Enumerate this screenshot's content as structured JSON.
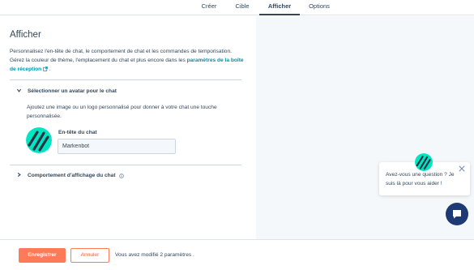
{
  "tabs": [
    {
      "label": "Créer",
      "active": false
    },
    {
      "label": "Cible",
      "active": false
    },
    {
      "label": "Afficher",
      "active": true
    },
    {
      "label": "Options",
      "active": false
    }
  ],
  "main": {
    "title": "Afficher",
    "description_part1": "Personnalisez l'en-tête de chat, le comportement de chat et les commandes de temporisation. Gérez la couleur de thème, l'emplacement du chat et plus encore dans les ",
    "description_link": "paramètres de la boîte de réception",
    "description_end": " .",
    "avatar_section": {
      "heading": "Sélectionner un avatar pour le chat",
      "description": "Ajoutez une image ou un logo personnalisé pour donner à votre chat une touche personnalisée.",
      "field_label": "En-tête du chat",
      "field_value": "Markenbot"
    },
    "behavior_section": {
      "heading": "Comportement d'affichage du chat"
    }
  },
  "footer": {
    "save_label": "Enregistrer",
    "cancel_label": "Annuler",
    "status": "Vous avez modifié 2 paramètres ."
  },
  "preview": {
    "welcome_message": "Avez-vous une question ? Je suis là pour vous aider !"
  },
  "colors": {
    "accent": "#ff7a59",
    "link": "#0091ae",
    "avatar_bg": "#00e6c3",
    "launcher": "#1e3a75",
    "text": "#33475b"
  },
  "icons": [
    "external-link-icon",
    "chevron-down-icon",
    "chevron-right-icon",
    "info-icon",
    "close-icon",
    "chat-icon"
  ]
}
